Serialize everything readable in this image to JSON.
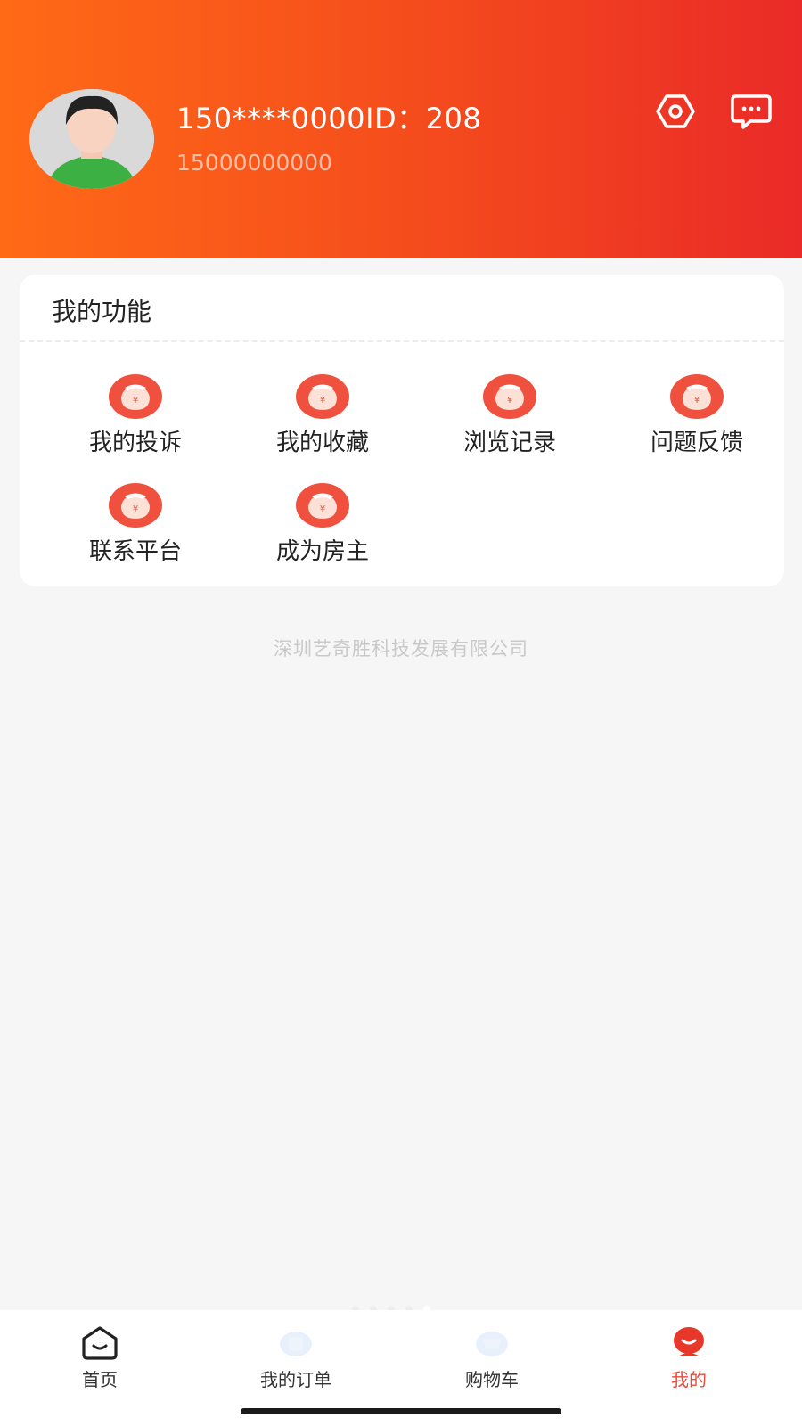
{
  "header": {
    "user_name_id": "150****0000ID：208",
    "phone": "15000000000",
    "icons": {
      "settings": "settings-hexagon-icon",
      "message": "message-chat-icon"
    },
    "colors": {
      "gradient_start": "#ff6a16",
      "gradient_end": "#ea2a28"
    }
  },
  "functions": {
    "title": "我的功能",
    "items": [
      {
        "label": "我的投诉",
        "icon": "money-bag-icon"
      },
      {
        "label": "我的收藏",
        "icon": "money-bag-icon"
      },
      {
        "label": "浏览记录",
        "icon": "money-bag-icon"
      },
      {
        "label": "问题反馈",
        "icon": "money-bag-icon"
      },
      {
        "label": "联系平台",
        "icon": "money-bag-icon"
      },
      {
        "label": "成为房主",
        "icon": "money-bag-icon"
      }
    ]
  },
  "footer": {
    "company": "深圳艺奇胜科技发展有限公司"
  },
  "tabbar": {
    "active_color": "#e74b3c",
    "tabs": [
      {
        "label": "首页",
        "icon": "home-icon"
      },
      {
        "label": "我的订单",
        "icon": "orders-icon"
      },
      {
        "label": "购物车",
        "icon": "cart-icon"
      },
      {
        "label": "我的",
        "icon": "profile-icon",
        "active": true
      }
    ]
  }
}
